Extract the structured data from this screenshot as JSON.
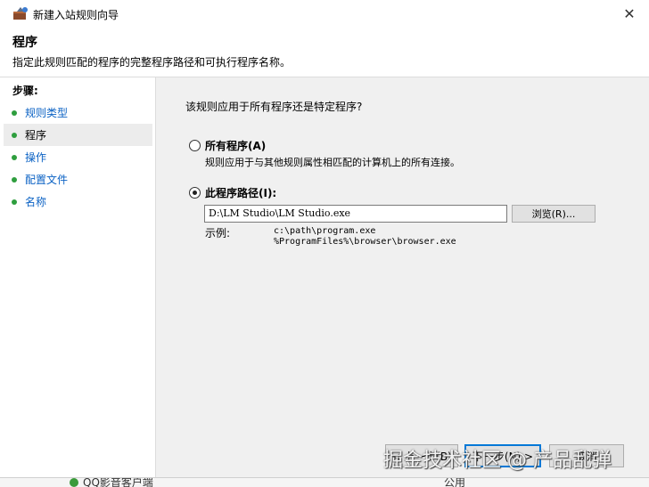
{
  "window": {
    "title": "新建入站规则向导",
    "icon": "firewall-wizard-icon",
    "close_glyph": "✕"
  },
  "header": {
    "title": "程序",
    "description": "指定此规则匹配的程序的完整程序路径和可执行程序名称。"
  },
  "steps": {
    "title": "步骤:",
    "items": [
      {
        "label": "规则类型",
        "active": false
      },
      {
        "label": "程序",
        "active": true
      },
      {
        "label": "操作",
        "active": false
      },
      {
        "label": "配置文件",
        "active": false
      },
      {
        "label": "名称",
        "active": false
      }
    ],
    "dot_color": "#2e9e3e"
  },
  "main": {
    "question": "该规则应用于所有程序还是特定程序?",
    "option_all": {
      "label": "所有程序(A)",
      "description": "规则应用于与其他规则属性相匹配的计算机上的所有连接。",
      "checked": false
    },
    "option_path": {
      "label": "此程序路径(I):",
      "checked": true,
      "value": "D:\\LM Studio\\LM Studio.exe"
    },
    "browse_label": "浏览(R)...",
    "example_label": "示例:",
    "example_lines": [
      "c:\\path\\program.exe",
      "%ProgramFiles%\\browser\\browser.exe"
    ]
  },
  "footer": {
    "back_label": "< 上一步(B)",
    "next_label": "下一步(N) >",
    "cancel_label": "取消"
  },
  "watermark": "掘金技术社区 @ 产品乱弹",
  "background_window": {
    "item_text": "QQ影音客户端",
    "item_extra": "公用"
  },
  "colors": {
    "accent": "#0078d7",
    "link": "#0b62c4",
    "content_bg": "#f0f0f0"
  }
}
